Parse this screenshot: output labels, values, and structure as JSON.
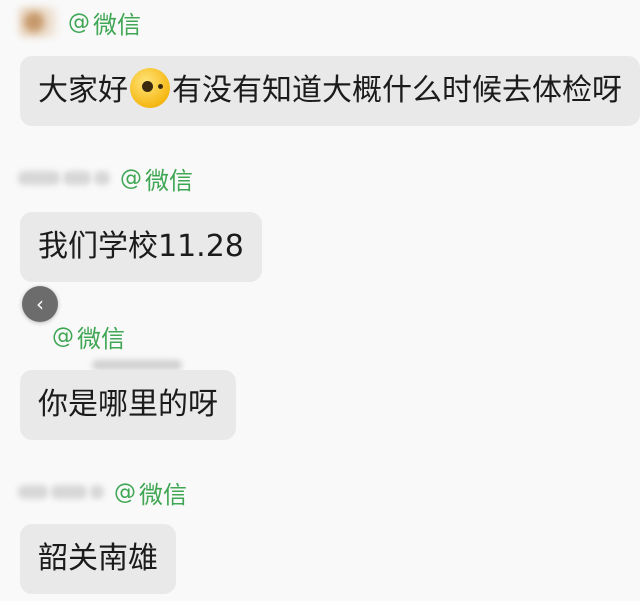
{
  "messages": [
    {
      "source": "微信",
      "text_parts": [
        "大家好",
        "有没有知道大概什么时候去体检呀"
      ]
    },
    {
      "source": "微信",
      "text": "我们学校11.28"
    },
    {
      "source": "微信",
      "text": "你是哪里的呀"
    },
    {
      "source": "微信",
      "text": "韶关南雄"
    }
  ],
  "icons": {
    "emoji": "smiley-emoji-icon",
    "back": "chevron-left-icon",
    "back_glyph": "‹"
  },
  "colors": {
    "source_green": "#3fa654",
    "bubble_bg": "#e9e9e9",
    "background": "#f9f9f9"
  }
}
